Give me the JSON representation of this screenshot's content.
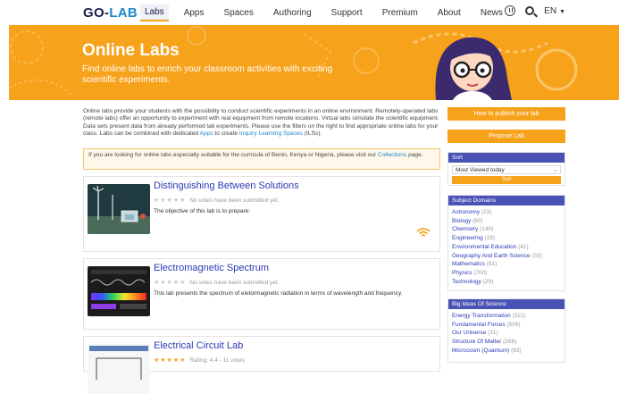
{
  "nav": {
    "logo_go": "GO-",
    "logo_lab": "LAB",
    "items": [
      "Labs",
      "Apps",
      "Spaces",
      "Authoring",
      "Support",
      "Premium",
      "About",
      "News"
    ],
    "active": "Labs",
    "language": "EN"
  },
  "hero": {
    "title": "Online Labs",
    "subtitle": "Find online labs to enrich your classroom activities with exciting scientific experiments."
  },
  "intro": {
    "text": "Online labs provide your students with the possibility to conduct scientific experiments in an online environment. Remotely-operated labs (remote labs) offer an opportunity to experiment with real equipment from remote locations. Virtual labs simulate the scientific equipment. Data sets present data from already performed lab experiments. Please use the filters on the right to find appropriate online labs for your class. Labs can be combined with dedicated ",
    "apps_link": "Apps",
    "mid": " to create ",
    "ils_link": "Inquiry Learning Spaces",
    "end": " (ILSs)."
  },
  "notice": {
    "text": "If you are looking for online labs especially suitable for the curricula of Benin, Kenya or Nigeria, please visit our ",
    "link": "Collections",
    "end": " page."
  },
  "labs": [
    {
      "title": "Distinguishing Between Solutions",
      "votes": "No votes have been submitted yet.",
      "description": "The objective of this lab is to prepare:"
    },
    {
      "title": "Electromagnetic Spectrum",
      "votes": "No votes have been submitted yet.",
      "description": "This lab presents the spectrum of eletormagnetic radiation in terms of wavelength and frequency."
    },
    {
      "title": "Electrical Circuit Lab",
      "votes": "Rating: 4.4 - 11 votes",
      "description": ""
    }
  ],
  "sidebar": {
    "publish_button": "How to publish your lab",
    "propose_button": "Propose Lab",
    "sort": {
      "header": "Sort",
      "selected": "Most Viewed today",
      "button": "Sort"
    },
    "subject_domains": {
      "header": "Subject Domains",
      "items": [
        {
          "name": "Astronomy",
          "count": "(23)"
        },
        {
          "name": "Biology",
          "count": "(60)"
        },
        {
          "name": "Chemistry",
          "count": "(140)"
        },
        {
          "name": "Engineering",
          "count": "(29)"
        },
        {
          "name": "Environmental Education",
          "count": "(41)"
        },
        {
          "name": "Geography And Earth Science",
          "count": "(33)"
        },
        {
          "name": "Mathematics",
          "count": "(81)"
        },
        {
          "name": "Physics",
          "count": "(700)"
        },
        {
          "name": "Technology",
          "count": "(29)"
        }
      ]
    },
    "big_ideas": {
      "header": "Big Ideas Of Science",
      "items": [
        {
          "name": "Energy Transformation",
          "count": "(321)"
        },
        {
          "name": "Fundamental Forces",
          "count": "(509)"
        },
        {
          "name": "Our Universe",
          "count": "(31)"
        },
        {
          "name": "Structure Of Matter",
          "count": "(266)"
        },
        {
          "name": "Microcosm (Quantum)",
          "count": "(63)"
        }
      ]
    }
  },
  "colors": {
    "accent": "#f7a21b",
    "panel_header": "#4a52b5",
    "link": "#2b3ab5"
  }
}
